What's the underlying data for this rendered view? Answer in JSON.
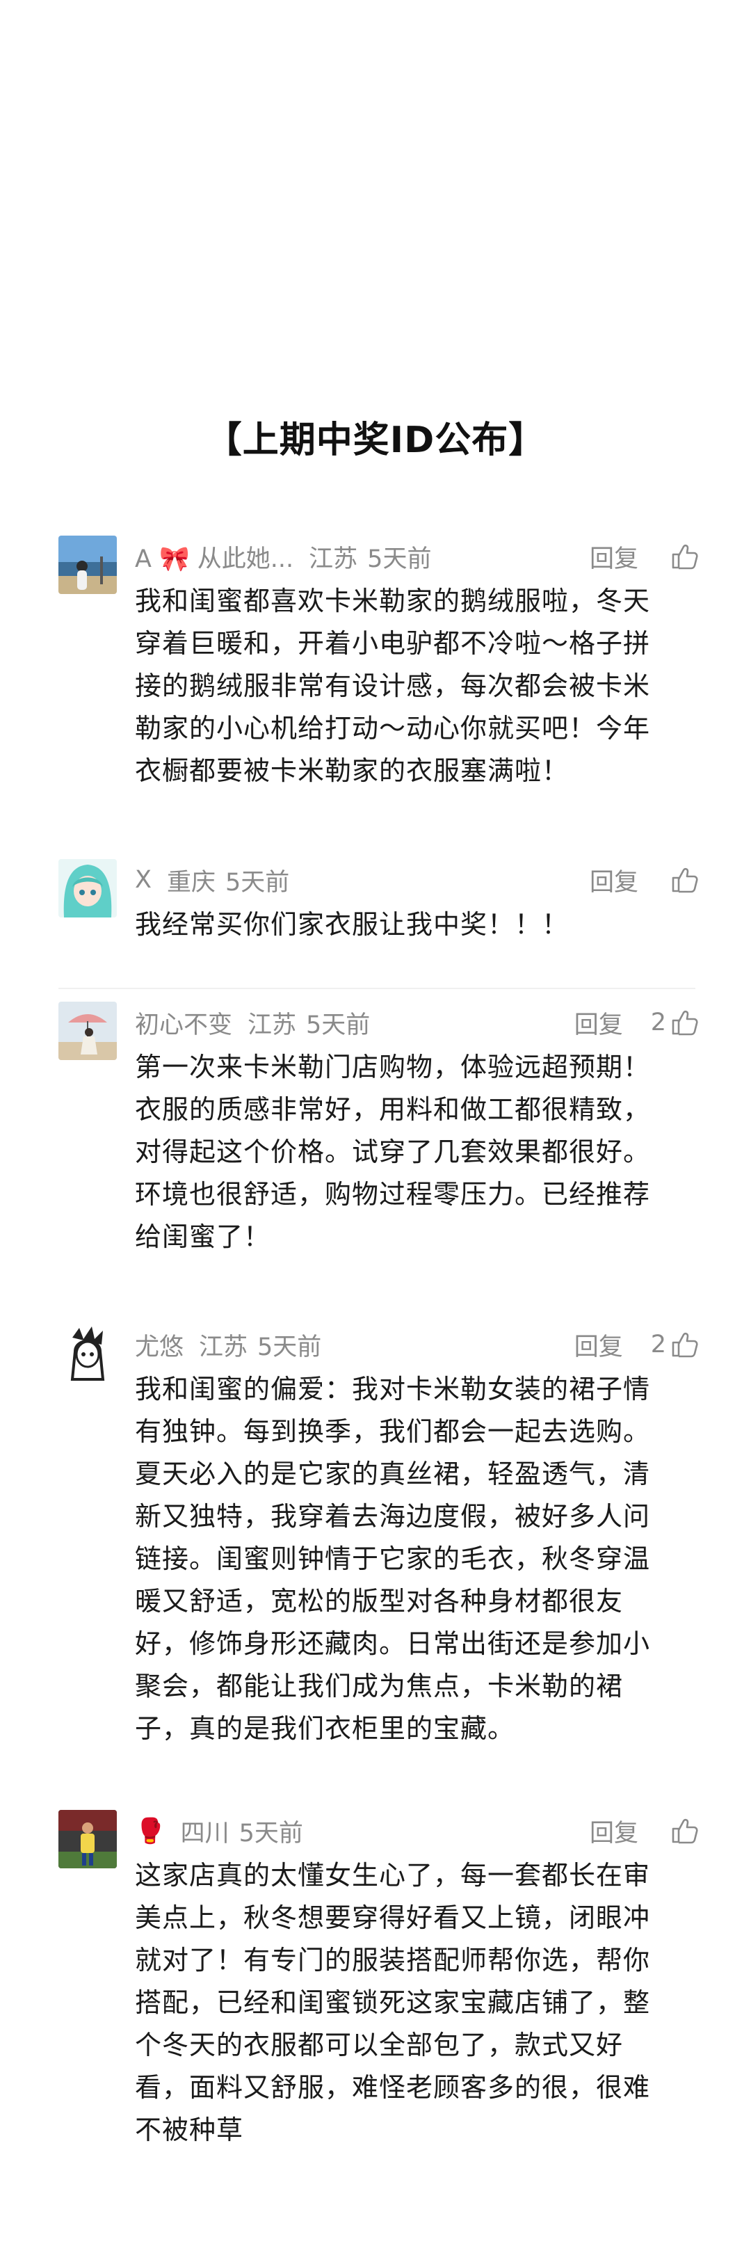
{
  "title": "【上期中奖ID公布】",
  "reply_label": "回复",
  "comments": [
    {
      "user": "A 🎀 从此她...",
      "location": "江苏",
      "time": "5天前",
      "likes": "",
      "avatar": "landscape-avatar",
      "text": "我和闺蜜都喜欢卡米勒家的鹅绒服啦，冬天\n穿着巨暖和，开着小电驴都不冷啦～格子拼\n接的鹅绒服非常有设计感，每次都会被卡米\n勒家的小心机给打动～动心你就买吧！今年\n衣橱都要被卡米勒家的衣服塞满啦！"
    },
    {
      "user": "X",
      "location": "重庆",
      "time": "5天前",
      "likes": "",
      "avatar": "anime-avatar",
      "text": "我经常买你们家衣服让我中奖！！！"
    },
    {
      "user": "初心不变",
      "location": "江苏",
      "time": "5天前",
      "likes": "2",
      "avatar": "umbrella-avatar",
      "text": "第一次来卡米勒门店购物，体验远超预期！\n衣服的质感非常好，用料和做工都很精致，\n对得起这个价格。试穿了几套效果都很好。\n环境也很舒适，购物过程零压力。已经推荐\n给闺蜜了！"
    },
    {
      "user": "尤悠",
      "location": "江苏",
      "time": "5天前",
      "likes": "2",
      "avatar": "sketch-avatar",
      "text": "我和闺蜜的偏爱：我对卡米勒女装的裙子情\n有独钟。每到换季，我们都会一起去选购。\n夏天必入的是它家的真丝裙，轻盈透气，清\n新又独特，我穿着去海边度假，被好多人问\n链接。闺蜜则钟情于它家的毛衣，秋冬穿温\n暖又舒适，宽松的版型对各种身材都很友\n好，修饰身形还藏肉。日常出街还是参加小\n聚会，都能让我们成为焦点，卡米勒的裙\n子，真的是我们衣柜里的宝藏。"
    },
    {
      "user": "🥊",
      "location": "四川",
      "time": "5天前",
      "likes": "",
      "avatar": "soccer-avatar",
      "text": "这家店真的太懂女生心了，每一套都长在审\n美点上，秋冬想要穿得好看又上镜，闭眼冲\n就对了！有专门的服装搭配师帮你选，帮你\n搭配，已经和闺蜜锁死这家宝藏店铺了，整\n个冬天的衣服都可以全部包了，款式又好\n看，面料又舒服，难怪老顾客多的很，很难\n不被种草"
    }
  ]
}
